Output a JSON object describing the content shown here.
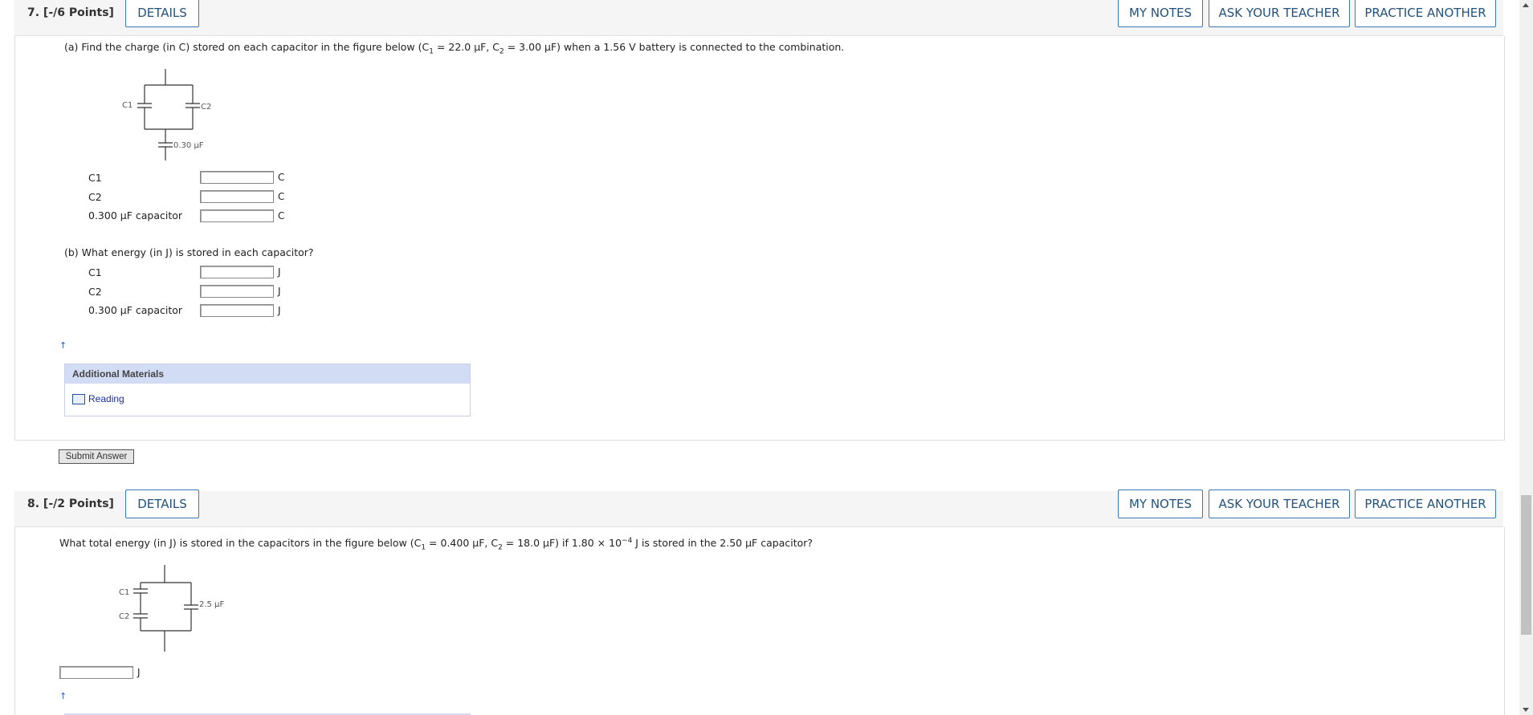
{
  "q7": {
    "number": "7.  [-/6 Points]",
    "details": "DETAILS",
    "my_notes": "MY NOTES",
    "ask_teacher": "ASK YOUR TEACHER",
    "practice": "PRACTICE ANOTHER",
    "part_a_prefix": "(a)  Find the charge (in C) stored on each capacitor in the figure below (C",
    "part_a_mid": " = 22.0 μF, C",
    "part_a_suffix": " = 3.00 μF) when a 1.56 V battery is connected to the combination.",
    "fig_c1": "C1",
    "fig_c2": "C2",
    "fig_cap": "0.30 μF",
    "rows_a": [
      {
        "label": "C1",
        "unit": "C"
      },
      {
        "label": "C2",
        "unit": "C"
      },
      {
        "label": "0.300 μF capacitor",
        "unit": "C"
      }
    ],
    "part_b": "(b)  What energy (in J) is stored in each capacitor?",
    "rows_b": [
      {
        "label": "C1",
        "unit": "J"
      },
      {
        "label": "C2",
        "unit": "J"
      },
      {
        "label": "0.300 μF capacitor",
        "unit": "J"
      }
    ],
    "additional_materials": "Additional Materials",
    "reading": "Reading",
    "submit": "Submit Answer"
  },
  "q8": {
    "number": "8.  [-/2 Points]",
    "details": "DETAILS",
    "my_notes": "MY NOTES",
    "ask_teacher": "ASK YOUR TEACHER",
    "practice": "PRACTICE ANOTHER",
    "q_prefix": "What total energy (in J) is stored in the capacitors in the figure below (C",
    "q_mid1": " = 0.400 μF, C",
    "q_mid2": " = 18.0 μF) if 1.80 × 10",
    "q_exp": "−4",
    "q_suffix": " J is stored in the 2.50 μF capacitor?",
    "fig_c1": "C1",
    "fig_c2": "C2",
    "fig_cap": "2.5 μF",
    "unit": "J"
  },
  "subs": {
    "one": "1",
    "two": "2"
  }
}
